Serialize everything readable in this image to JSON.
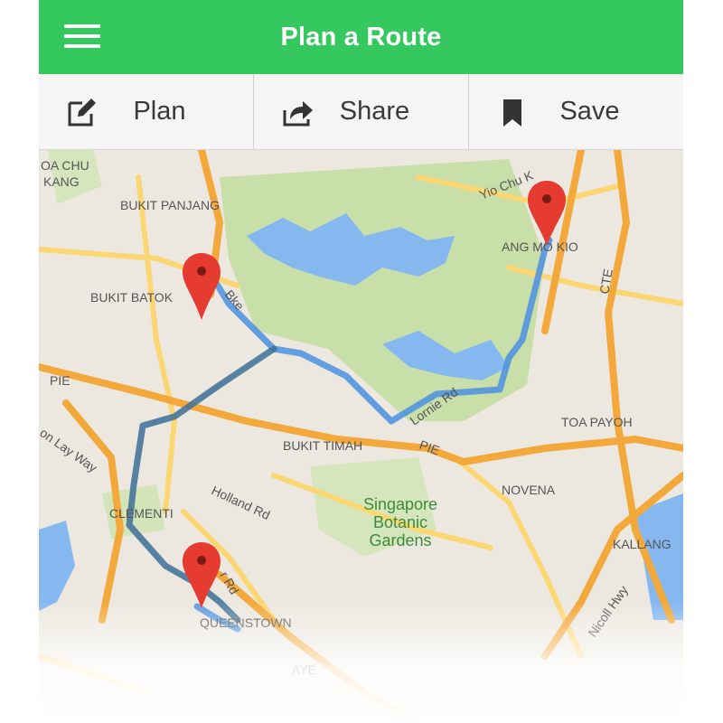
{
  "header": {
    "title": "Plan a Route",
    "menu_icon": "menu-icon"
  },
  "toolbar": {
    "items": [
      {
        "label": "Plan",
        "icon": "edit-icon"
      },
      {
        "label": "Share",
        "icon": "share-icon"
      },
      {
        "label": "Save",
        "icon": "bookmark-icon"
      }
    ]
  },
  "map": {
    "labels": {
      "choa_chu_kang": "OA CHU",
      "choa_chu_kang_2": "KANG",
      "bukit_panjang": "BUKIT PANJANG",
      "bukit_batok": "BUKIT BATOK",
      "ang_mo_kio": "ANG MO KIO",
      "yio_chu_kang": "Yio Chu K",
      "cte": "CTE",
      "pie_left": "PIE",
      "pie_right": "PIE",
      "lornie_rd": "Lornie Rd",
      "toa_payoh": "TOA PAYOH",
      "bukit_timah": "BUKIT TIMAH",
      "novena": "NOVENA",
      "jurong_east": "on Lay Way",
      "clementi": "CLEMENTI",
      "holland_rd": "Holland Rd",
      "botanic_1": "Singapore",
      "botanic_2": "Botanic",
      "botanic_3": "Gardens",
      "kallang": "KALLANG",
      "nicoll_hwy": "Nicoll Hwy",
      "queenstown": "QUEENSTOWN",
      "ayer": "AYE",
      "rd_small": "r Rd",
      "dunearn": "Bke",
      "singapore_faded": "Singapore"
    },
    "markers": [
      "map-marker-bukit-batok",
      "map-marker-ang-mo-kio",
      "map-marker-queenstown"
    ],
    "colors": {
      "land": "#ece8df",
      "park": "#c9dfa9",
      "water": "#86b8f0",
      "highway": "#f2a83a",
      "arterial": "#fbd774",
      "route": "#4a90e2",
      "route_dark": "#3d6e98",
      "marker": "#e53b30"
    }
  }
}
